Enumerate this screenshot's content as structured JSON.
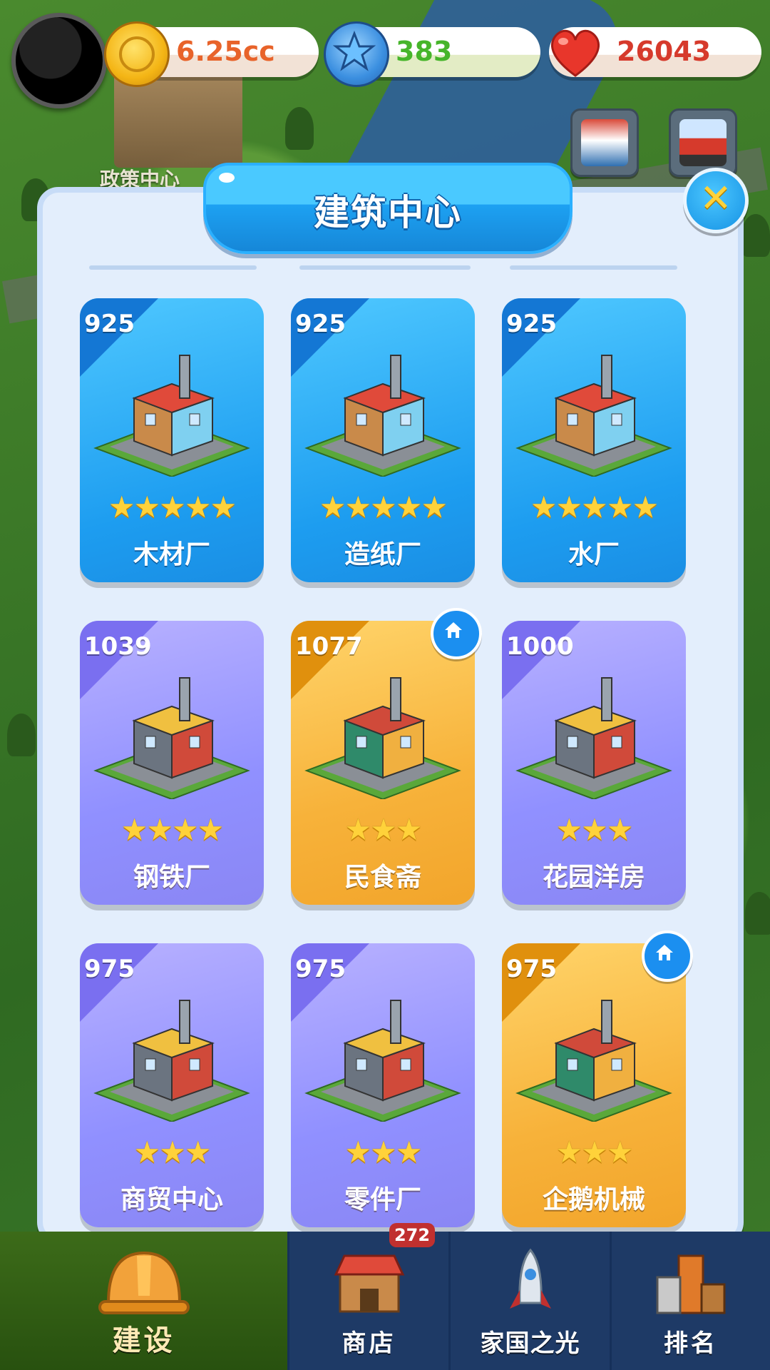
{
  "hud": {
    "coins": "6.25cc",
    "stars": "383",
    "hearts": "26043"
  },
  "background": {
    "policy_center_label": "政策中心"
  },
  "panel": {
    "title": "建筑中心",
    "close_icon": "close-x-icon"
  },
  "buildings": [
    {
      "level": "925",
      "name": "木材厂",
      "stars": "★★★★★",
      "theme": "blue"
    },
    {
      "level": "925",
      "name": "造纸厂",
      "stars": "★★★★★",
      "theme": "blue"
    },
    {
      "level": "925",
      "name": "水厂",
      "stars": "★★★★★",
      "theme": "blue"
    },
    {
      "level": "1039",
      "name": "钢铁厂",
      "stars": "★★★★",
      "theme": "purple"
    },
    {
      "level": "1077",
      "name": "民食斋",
      "stars": "★★★",
      "theme": "gold",
      "home": true
    },
    {
      "level": "1000",
      "name": "花园洋房",
      "stars": "★★★",
      "theme": "purple"
    },
    {
      "level": "975",
      "name": "商贸中心",
      "stars": "★★★",
      "theme": "purple"
    },
    {
      "level": "975",
      "name": "零件厂",
      "stars": "★★★",
      "theme": "purple"
    },
    {
      "level": "975",
      "name": "企鹅机械",
      "stars": "★★★",
      "theme": "gold",
      "home": true
    }
  ],
  "nav": {
    "count": "272",
    "tabs": [
      {
        "label": "建设",
        "icon": "hard-hat-icon",
        "active": true
      },
      {
        "label": "商店",
        "icon": "shop-icon"
      },
      {
        "label": "家国之光",
        "icon": "rocket-icon"
      },
      {
        "label": "排名",
        "icon": "podium-icon"
      }
    ]
  },
  "colors": {
    "coin_text": "#e8632a",
    "star_text": "#46b52a",
    "heart_text": "#d63a2c",
    "blue_card": "#1d9df0",
    "purple_card": "#9090ff",
    "gold_card": "#f7b23a"
  }
}
